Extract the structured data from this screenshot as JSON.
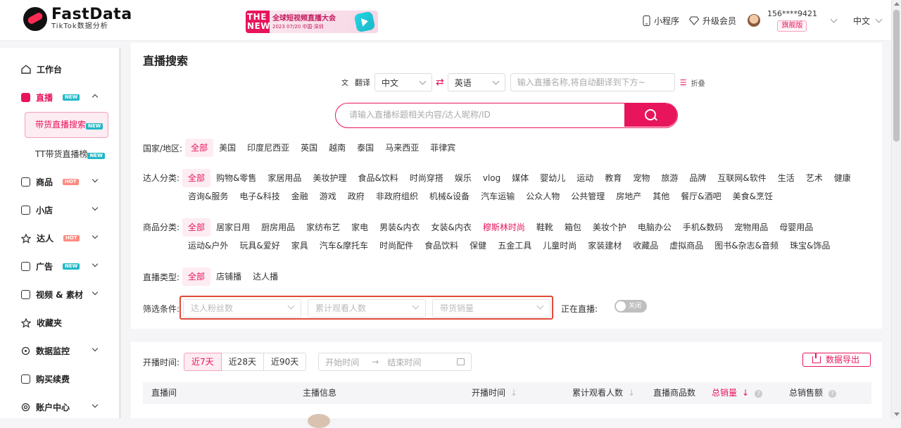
{
  "brand": {
    "name": "FastData",
    "sub": "TikTok数据分析"
  },
  "banner": {
    "the": "THE",
    "new": "NEW",
    "title": "全球短视频直播大会",
    "date": "2023   07/20 中国·深圳"
  },
  "header": {
    "mini_program": "小程序",
    "upgrade": "升级会员",
    "user_phone": "156****9421",
    "vip_level": "旗舰版",
    "language": "中文"
  },
  "sidebar": {
    "items": [
      {
        "label": "工作台"
      },
      {
        "label": "直播",
        "badge": "NEW"
      },
      {
        "label": "商品",
        "badge": "HOT"
      },
      {
        "label": "小店"
      },
      {
        "label": "达人",
        "badge": "HOT"
      },
      {
        "label": "广告",
        "badge": "NEW"
      },
      {
        "label": "视频 & 素材"
      },
      {
        "label": "收藏夹"
      },
      {
        "label": "数据监控"
      },
      {
        "label": "购买续费"
      },
      {
        "label": "账户中心"
      }
    ],
    "sub": [
      {
        "label": "带货直播搜索",
        "badge": "NEW"
      },
      {
        "label": "TT带货直播榜",
        "badge": "NEW"
      }
    ]
  },
  "page": {
    "title": "直播搜索"
  },
  "translate": {
    "label": "翻译",
    "from": "中文",
    "to": "英语",
    "placeholder": "输入直播名称,将自动翻译到下方~",
    "fold": "折叠"
  },
  "search": {
    "placeholder": "请输入直播标题相关内容/达人昵称/ID"
  },
  "filters": {
    "country": {
      "label": "国家/地区:",
      "options": [
        "全部",
        "美国",
        "印度尼西亚",
        "英国",
        "越南",
        "泰国",
        "马来西亚",
        "菲律宾"
      ]
    },
    "creator": {
      "label": "达人分类:",
      "options": [
        "全部",
        "购物&零售",
        "家居用品",
        "美妆护理",
        "食品&饮料",
        "时尚穿搭",
        "娱乐",
        "vlog",
        "媒体",
        "婴幼儿",
        "运动",
        "教育",
        "宠物",
        "旅游",
        "品牌",
        "互联网&软件",
        "生活",
        "艺术",
        "健康",
        "咨询&服务",
        "电子&科技",
        "金融",
        "游戏",
        "政府",
        "非政府组织",
        "机械&设备",
        "汽车运输",
        "公众人物",
        "公共管理",
        "房地产",
        "其他",
        "餐厅&酒吧",
        "美食&烹饪"
      ]
    },
    "product": {
      "label": "商品分类:",
      "options": [
        "全部",
        "居家日用",
        "厨房用品",
        "家纺布艺",
        "家电",
        "男装&内衣",
        "女装&内衣",
        "穆斯林时尚",
        "鞋靴",
        "箱包",
        "美妆个护",
        "电脑办公",
        "手机&数码",
        "宠物用品",
        "母婴用品",
        "运动&户外",
        "玩具&爱好",
        "家具",
        "汽车&摩托车",
        "时尚配件",
        "食品饮料",
        "保健",
        "五金工具",
        "儿童时尚",
        "家装建材",
        "收藏品",
        "虚拟商品",
        "图书&杂志&音频",
        "珠宝&饰品"
      ]
    },
    "live_type": {
      "label": "直播类型:",
      "options": [
        "全部",
        "店铺播",
        "达人播"
      ]
    },
    "conditions": {
      "label": "筛选条件:",
      "fans": "达人粉丝数",
      "viewers": "累计观看人数",
      "sales": "带货销量"
    },
    "live_now": {
      "label": "正在直播:",
      "toggle": "关闭"
    }
  },
  "time": {
    "label": "开播时间:",
    "ranges": [
      "近7天",
      "近28天",
      "近90天"
    ],
    "start": "开始时间",
    "arrow": "→",
    "end": "结束时间",
    "export": "数据导出"
  },
  "table": {
    "headers": [
      "直播间",
      "主播信息",
      "开播时间",
      "累计观看人数",
      "直播商品数",
      "总销量",
      "总销售额"
    ]
  },
  "colors": {
    "accent": "#e8155c",
    "highlight_border": "#e04a3a"
  }
}
